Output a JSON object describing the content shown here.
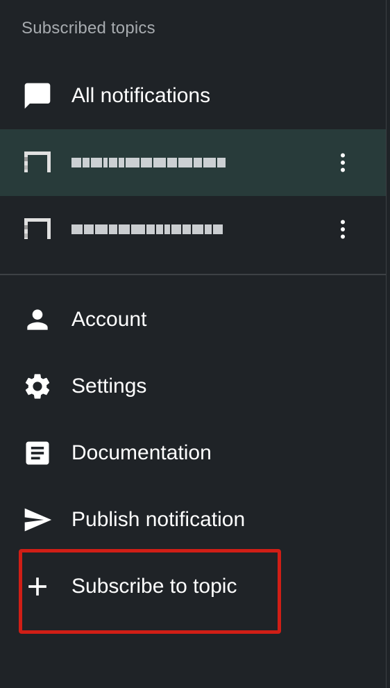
{
  "drawer": {
    "section_header": "Subscribed topics",
    "all_notifications_label": "All notifications",
    "topics": [
      {
        "label_obscured": true,
        "selected": true
      },
      {
        "label_obscured": true,
        "selected": false
      }
    ],
    "nav": {
      "account_label": "Account",
      "settings_label": "Settings",
      "documentation_label": "Documentation",
      "publish_label": "Publish notification",
      "subscribe_label": "Subscribe to topic"
    },
    "icons": {
      "all_notifications": "chat-bubble-icon",
      "topic": "topic-icon",
      "more": "more-vert-icon",
      "account": "person-icon",
      "settings": "gear-icon",
      "documentation": "article-icon",
      "publish": "send-icon",
      "subscribe": "plus-icon"
    },
    "colors": {
      "background": "#1f2327",
      "selected_background": "#283b3a",
      "header_text": "#a7abaf",
      "highlight_border": "#d01e16"
    }
  }
}
